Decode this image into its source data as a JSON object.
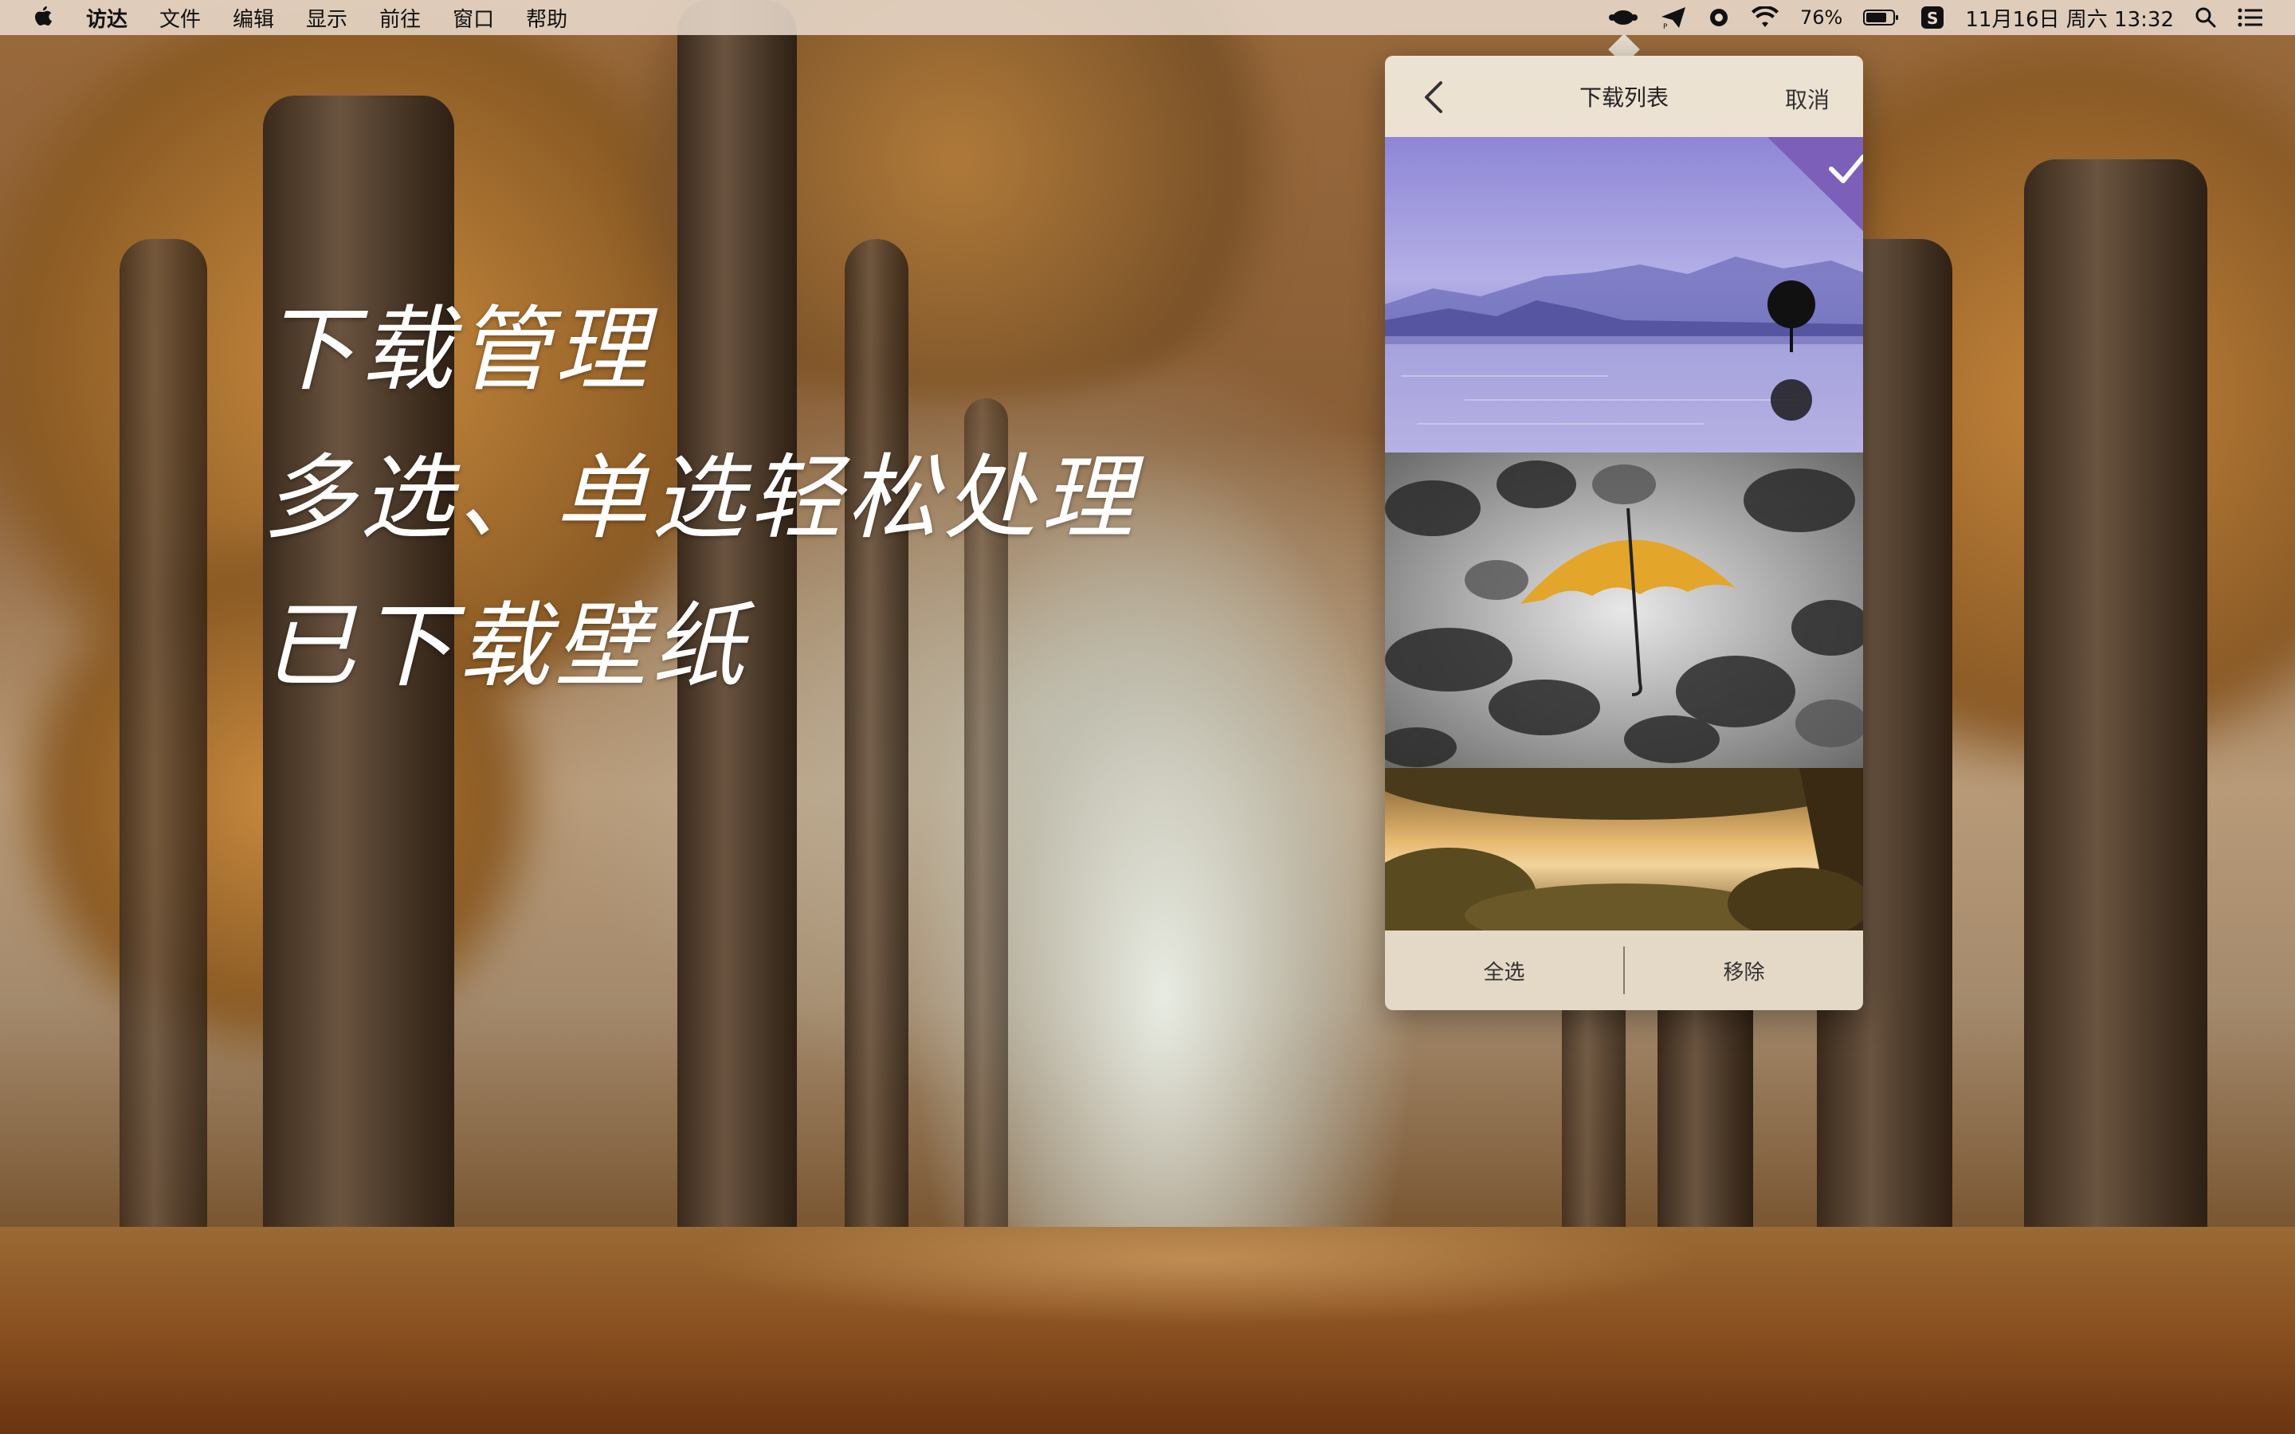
{
  "menubar": {
    "app_name": "访达",
    "items": [
      "文件",
      "编辑",
      "显示",
      "前往",
      "窗口",
      "帮助"
    ],
    "battery_percent": "76%",
    "clock": "11月16日 周六 13:32",
    "icons": [
      "apple-icon",
      "cloud-app-icon",
      "paper-plane-icon",
      "record-icon",
      "wifi-icon",
      "battery-icon",
      "s-app-icon",
      "search-icon",
      "list-icon"
    ]
  },
  "caption": {
    "line1": "下载管理",
    "line2": "多选、单选轻松处理",
    "line3": "已下载壁纸"
  },
  "panel": {
    "title": "下载列表",
    "cancel_label": "取消",
    "select_all_label": "全选",
    "remove_label": "移除",
    "accent_color": "#7b5fb8",
    "wallpapers": [
      {
        "name": "purple-lake-wallpaper",
        "selected": true
      },
      {
        "name": "umbrellas-wallpaper",
        "selected": false
      },
      {
        "name": "sunset-tree-wallpaper",
        "selected": false
      }
    ]
  }
}
